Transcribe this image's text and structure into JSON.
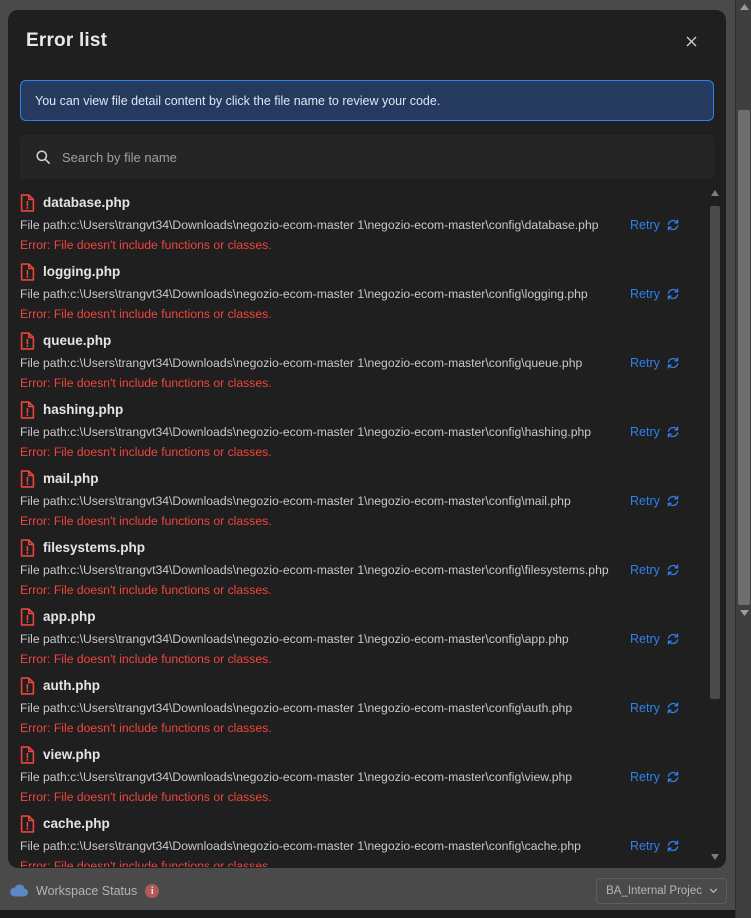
{
  "modal": {
    "title": "Error list",
    "close_icon": "close-icon",
    "info_banner": {
      "text": "You can view file detail content by click the file name to review your code."
    },
    "search": {
      "icon": "search-icon",
      "placeholder": "Search by file name",
      "value": ""
    },
    "retry_label": "Retry",
    "retry_icon": "refresh-icon",
    "file_icon": "file-error-icon",
    "errors": [
      {
        "file_name": "database.php",
        "path": "File path:c:\\Users\\trangvt34\\Downloads\\negozio-ecom-master 1\\negozio-ecom-master\\config\\database.php",
        "error": "Error: File doesn't include functions or classes."
      },
      {
        "file_name": "logging.php",
        "path": "File path:c:\\Users\\trangvt34\\Downloads\\negozio-ecom-master 1\\negozio-ecom-master\\config\\logging.php",
        "error": "Error: File doesn't include functions or classes."
      },
      {
        "file_name": "queue.php",
        "path": "File path:c:\\Users\\trangvt34\\Downloads\\negozio-ecom-master 1\\negozio-ecom-master\\config\\queue.php",
        "error": "Error: File doesn't include functions or classes."
      },
      {
        "file_name": "hashing.php",
        "path": "File path:c:\\Users\\trangvt34\\Downloads\\negozio-ecom-master 1\\negozio-ecom-master\\config\\hashing.php",
        "error": "Error: File doesn't include functions or classes."
      },
      {
        "file_name": "mail.php",
        "path": "File path:c:\\Users\\trangvt34\\Downloads\\negozio-ecom-master 1\\negozio-ecom-master\\config\\mail.php",
        "error": "Error: File doesn't include functions or classes."
      },
      {
        "file_name": "filesystems.php",
        "path": "File path:c:\\Users\\trangvt34\\Downloads\\negozio-ecom-master 1\\negozio-ecom-master\\config\\filesystems.php",
        "error": "Error: File doesn't include functions or classes."
      },
      {
        "file_name": "app.php",
        "path": "File path:c:\\Users\\trangvt34\\Downloads\\negozio-ecom-master 1\\negozio-ecom-master\\config\\app.php",
        "error": "Error: File doesn't include functions or classes."
      },
      {
        "file_name": "auth.php",
        "path": "File path:c:\\Users\\trangvt34\\Downloads\\negozio-ecom-master 1\\negozio-ecom-master\\config\\auth.php",
        "error": "Error: File doesn't include functions or classes."
      },
      {
        "file_name": "view.php",
        "path": "File path:c:\\Users\\trangvt34\\Downloads\\negozio-ecom-master 1\\negozio-ecom-master\\config\\view.php",
        "error": "Error: File doesn't include functions or classes."
      },
      {
        "file_name": "cache.php",
        "path": "File path:c:\\Users\\trangvt34\\Downloads\\negozio-ecom-master 1\\negozio-ecom-master\\config\\cache.php",
        "error": "Error: File doesn't include functions or classes."
      }
    ]
  },
  "status_bar": {
    "cloud_icon": "cloud-icon",
    "workspace_label": "Workspace Status",
    "info_badge": "i",
    "project": {
      "label": "BA_Internal Projec",
      "chevron_icon": "chevron-down-icon"
    }
  },
  "colors": {
    "accent_blue": "#2f80ed",
    "error_red": "#f0453c",
    "modal_bg": "#1f1f1f",
    "banner_bg": "#253a5e",
    "backdrop": "#4a4a4a"
  }
}
